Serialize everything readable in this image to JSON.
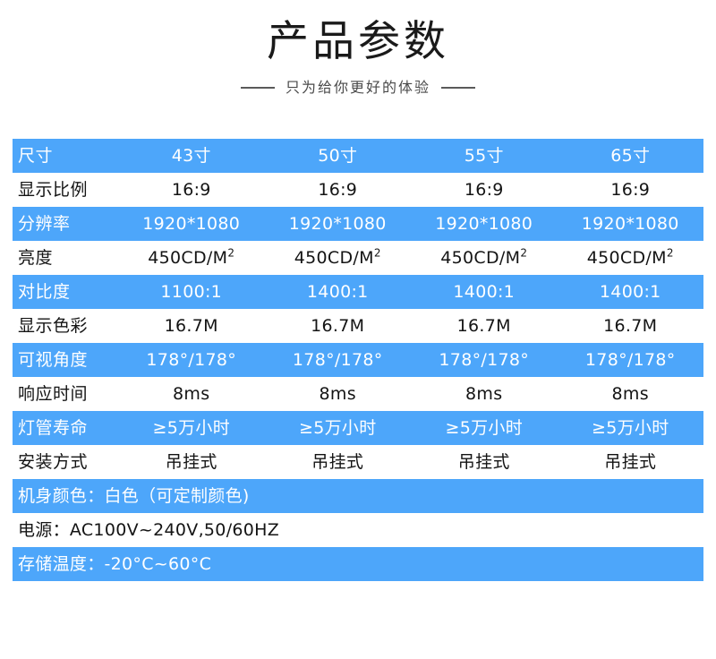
{
  "header": {
    "title": "产品参数",
    "subtitle": "只为给你更好的体验"
  },
  "colors": {
    "accent_blue": "#4da6fa",
    "blue_row_text": "#ffffff",
    "white_row_text": "#141414",
    "title_text": "#1a1a1a",
    "subtitle_text": "#4a4a4a"
  },
  "table": {
    "columns": [
      "尺寸",
      "43寸",
      "50寸",
      "55寸",
      "65寸"
    ],
    "rows": [
      {
        "label": "尺寸",
        "values": [
          "43寸",
          "50寸",
          "55寸",
          "65寸"
        ],
        "style": "blue"
      },
      {
        "label": "显示比例",
        "values": [
          "16:9",
          "16:9",
          "16:9",
          "16:9"
        ],
        "style": "white"
      },
      {
        "label": "分辨率",
        "values": [
          "1920*1080",
          "1920*1080",
          "1920*1080",
          "1920*1080"
        ],
        "style": "blue"
      },
      {
        "label": "亮度",
        "values": [
          "450CD/M2",
          "450CD/M2",
          "450CD/M2",
          "450CD/M2"
        ],
        "style": "white",
        "superscript": "2",
        "base": "450CD/M"
      },
      {
        "label": "对比度",
        "values": [
          "1100:1",
          "1400:1",
          "1400:1",
          "1400:1"
        ],
        "style": "blue"
      },
      {
        "label": "显示色彩",
        "values": [
          "16.7M",
          "16.7M",
          "16.7M",
          "16.7M"
        ],
        "style": "white"
      },
      {
        "label": "可视角度",
        "values": [
          "178°/178°",
          "178°/178°",
          "178°/178°",
          "178°/178°"
        ],
        "style": "blue"
      },
      {
        "label": "响应时间",
        "values": [
          "8ms",
          "8ms",
          "8ms",
          "8ms"
        ],
        "style": "white"
      },
      {
        "label": "灯管寿命",
        "values": [
          "≥5万小时",
          "≥5万小时",
          "≥5万小时",
          "≥5万小时"
        ],
        "style": "blue"
      },
      {
        "label": "安装方式",
        "values": [
          "吊挂式",
          "吊挂式",
          "吊挂式",
          "吊挂式"
        ],
        "style": "white"
      }
    ],
    "full_rows": [
      {
        "text": "机身颜色：白色（可定制颜色)",
        "style": "blue"
      },
      {
        "text": "电源：AC100V~240V,50/60HZ",
        "style": "white"
      },
      {
        "text": "存储温度：-20°C~60°C",
        "style": "blue"
      }
    ]
  }
}
